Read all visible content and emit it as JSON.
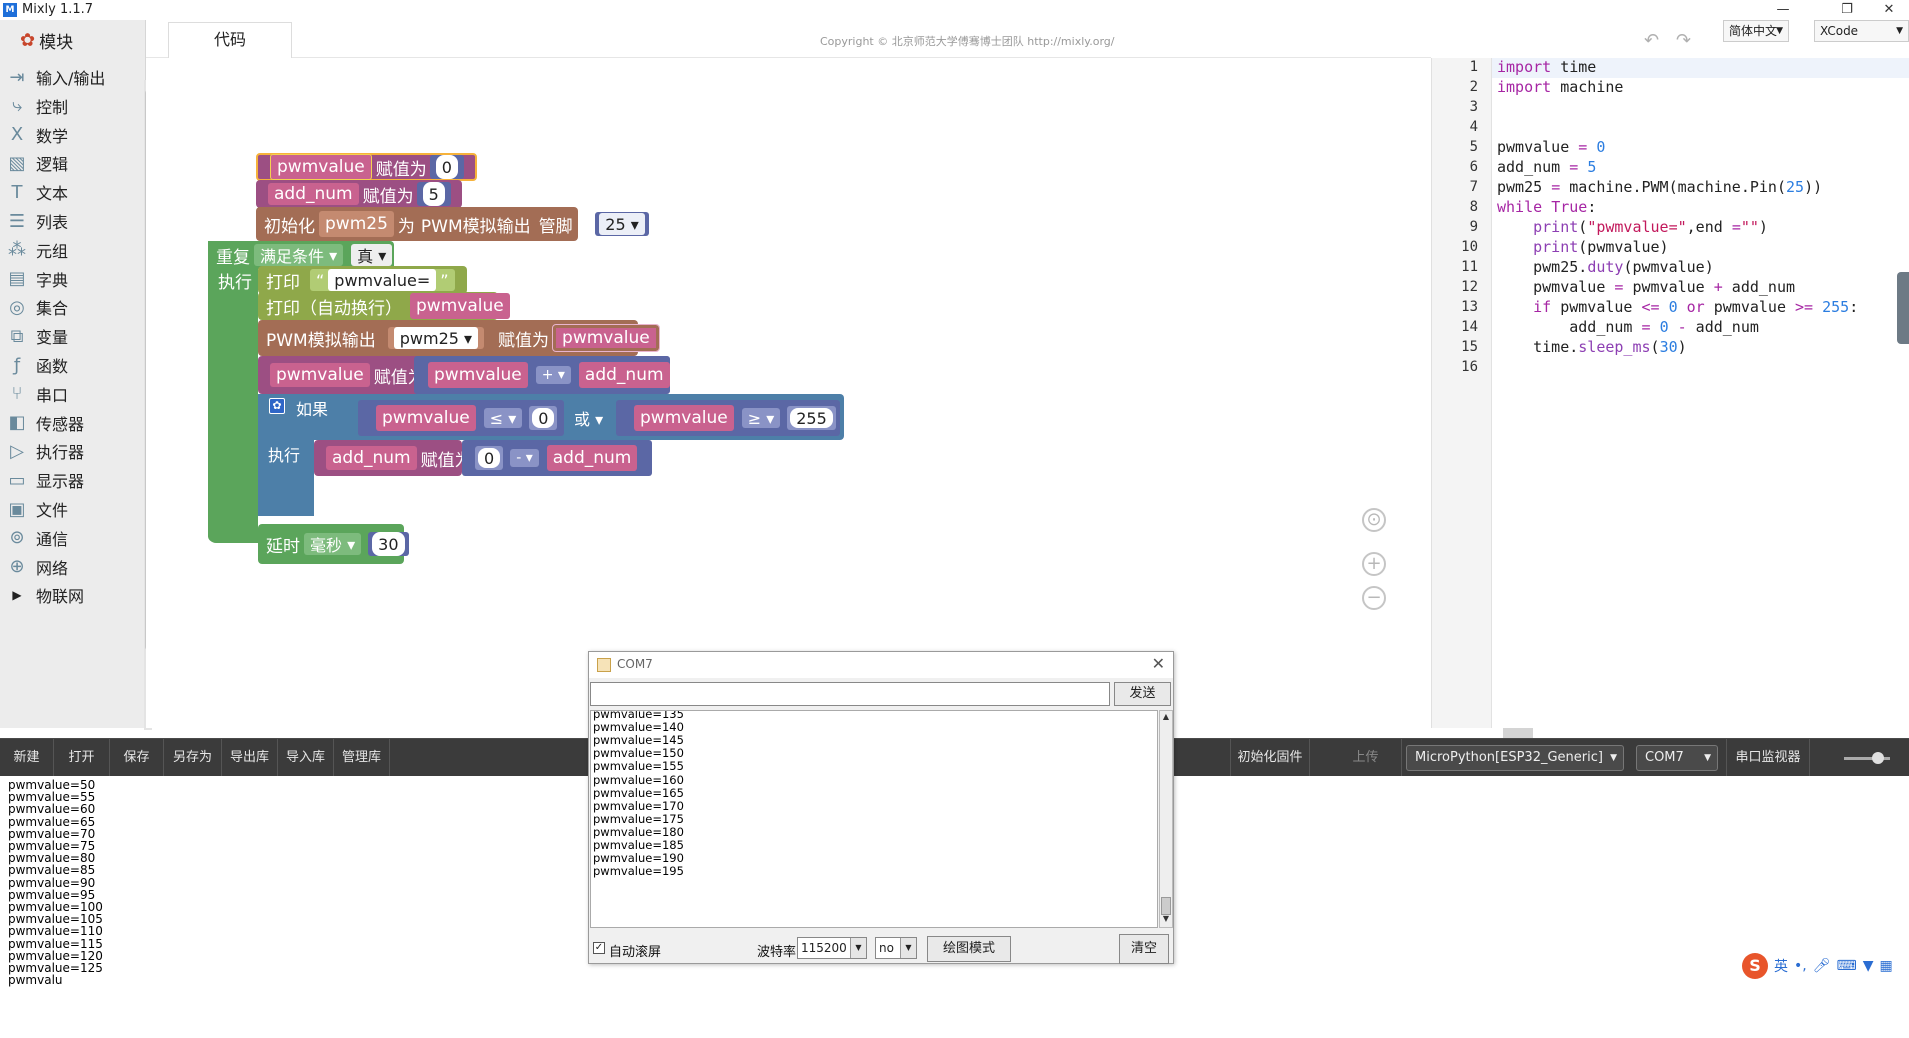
{
  "window": {
    "title": "Mixly 1.1.7",
    "logo_text": "M",
    "minimize": "—",
    "restore": "❐",
    "close": "✕"
  },
  "sidebar": {
    "header": "模块",
    "items": [
      {
        "label": "输入/输出",
        "icon": "input-output-icon",
        "glyph": "⇥"
      },
      {
        "label": "控制",
        "icon": "control-icon",
        "glyph": "⤷"
      },
      {
        "label": "数学",
        "icon": "math-icon",
        "glyph": "Ⅹ"
      },
      {
        "label": "逻辑",
        "icon": "logic-icon",
        "glyph": "▧"
      },
      {
        "label": "文本",
        "icon": "text-icon",
        "glyph": "T"
      },
      {
        "label": "列表",
        "icon": "list-icon",
        "glyph": "☰"
      },
      {
        "label": "元组",
        "icon": "tuple-icon",
        "glyph": "⁂"
      },
      {
        "label": "字典",
        "icon": "dict-icon",
        "glyph": "▤"
      },
      {
        "label": "集合",
        "icon": "set-icon",
        "glyph": "◎"
      },
      {
        "label": "变量",
        "icon": "variable-icon",
        "glyph": "⧉"
      },
      {
        "label": "函数",
        "icon": "function-icon",
        "glyph": "ƒ"
      },
      {
        "label": "串口",
        "icon": "serial-icon",
        "glyph": "⑂"
      },
      {
        "label": "传感器",
        "icon": "sensor-icon",
        "glyph": "◧"
      },
      {
        "label": "执行器",
        "icon": "actuator-icon",
        "glyph": "▷"
      },
      {
        "label": "显示器",
        "icon": "display-icon",
        "glyph": "▭"
      },
      {
        "label": "文件",
        "icon": "file-icon",
        "glyph": "▣"
      },
      {
        "label": "通信",
        "icon": "communication-icon",
        "glyph": "⊚"
      },
      {
        "label": "网络",
        "icon": "network-icon",
        "glyph": "⊕"
      },
      {
        "label": "物联网",
        "icon": "iot-icon",
        "glyph": "▶"
      }
    ]
  },
  "header": {
    "tab_code": "代码",
    "copyright": "Copyright © 北京师范大学傅骞博士团队 http://mixly.org/",
    "undo": "↶",
    "redo": "↷",
    "language": "简体中文",
    "theme": "XCode"
  },
  "blocks": {
    "b1_var": "pwmvalue",
    "b1_assign": "赋值为",
    "b1_val": "0",
    "b2_var": "add_num",
    "b2_assign": "赋值为",
    "b2_val": "5",
    "b3_init": "初始化",
    "b3_var": "pwm25",
    "b3_as": "为",
    "b3_type": "PWM模拟输出",
    "b3_pin_label": "管脚 #",
    "b3_pin": "25",
    "repeat": "重复",
    "repeat_mode": "满足条件",
    "repeat_cond": "真",
    "do": "执行",
    "print1": "打印",
    "print1_str": "pwmvalue=",
    "print2": "打印（自动换行）",
    "print2_var": "pwmvalue",
    "pwm_out": "PWM模拟输出",
    "pwm_out_var": "pwm25",
    "pwm_out_assign": "赋值为",
    "pwm_out_val": "pwmvalue",
    "set_var": "pwmvalue",
    "set_assign": "赋值为",
    "set_a": "pwmvalue",
    "set_op": "+",
    "set_b": "add_num",
    "if": "如果",
    "if_a": "pwmvalue",
    "if_op1": "≤",
    "if_v1": "0",
    "if_or": "或",
    "if_b": "pwmvalue",
    "if_op2": "≥",
    "if_v2": "255",
    "if_do": "执行",
    "if_set_var": "add_num",
    "if_set_assign": "赋值为",
    "if_set_a": "0",
    "if_set_op": "-",
    "if_set_b": "add_num",
    "delay": "延时",
    "delay_unit": "毫秒",
    "delay_val": "30"
  },
  "code": {
    "line_numbers": [
      "1",
      "2",
      "3",
      "4",
      "5",
      "6",
      "7",
      "8",
      "9",
      "10",
      "11",
      "12",
      "13",
      "14",
      "15",
      "16"
    ]
  },
  "toolbar": {
    "new": "新建",
    "open": "打开",
    "save": "保存",
    "save_as": "另存为",
    "export_lib": "导出库",
    "import_lib": "导入库",
    "manage_lib": "管理库",
    "init_firmware": "初始化固件",
    "upload": "上传",
    "board": "MicroPython[ESP32_Generic]",
    "port": "COM7",
    "serial_monitor": "串口监视器"
  },
  "console_lines": [
    "pwmvalue=50",
    "pwmvalue=55",
    "pwmvalue=60",
    "pwmvalue=65",
    "pwmvalue=70",
    "pwmvalue=75",
    "pwmvalue=80",
    "pwmvalue=85",
    "pwmvalue=90",
    "pwmvalue=95",
    "pwmvalue=100",
    "pwmvalue=105",
    "pwmvalue=110",
    "pwmvalue=115",
    "pwmvalue=120",
    "pwmvalue=125",
    "pwmvalu"
  ],
  "serial_dialog": {
    "title": "COM7",
    "send": "发送",
    "lines": [
      "pwmvalue=135",
      "pwmvalue=140",
      "pwmvalue=145",
      "pwmvalue=150",
      "pwmvalue=155",
      "pwmvalue=160",
      "pwmvalue=165",
      "pwmvalue=170",
      "pwmvalue=175",
      "pwmvalue=180",
      "pwmvalue=185",
      "pwmvalue=190",
      "pwmvalue=195"
    ],
    "auto_scroll": "自动滚屏",
    "baud_label": "波特率",
    "baud": "115200",
    "parity": "no",
    "plot_mode": "绘图模式",
    "clear": "清空"
  },
  "ime": {
    "s": "S",
    "lang": "英"
  }
}
